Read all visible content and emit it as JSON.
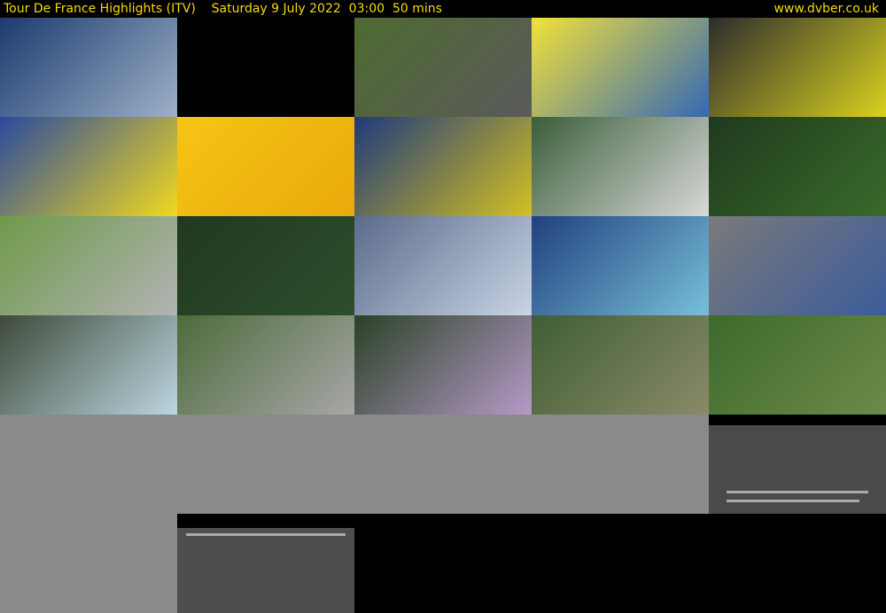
{
  "header": {
    "title": "Tour De France Highlights (ITV)",
    "date": "Saturday 9 July 2022",
    "time": "03:00",
    "duration": "50 mins",
    "site": "www.dvber.co.uk"
  },
  "thumbnails": [
    {
      "text": "",
      "colors": [
        "#1b3b6f",
        "#9db0c7"
      ]
    },
    {
      "text": "",
      "colors": [
        "#000000",
        "#000000"
      ]
    },
    {
      "text": "",
      "colors": [
        "#4e6a2f",
        "#5a5a5a"
      ]
    },
    {
      "text": "",
      "colors": [
        "#f3e13a",
        "#3469b4"
      ]
    },
    {
      "text": "",
      "colors": [
        "#2c2c2c",
        "#d8d11f"
      ]
    },
    {
      "text": "",
      "colors": [
        "#2b4a9d",
        "#f0d91f"
      ]
    },
    {
      "text": "",
      "colors": [
        "#f6c515",
        "#e9a90b"
      ]
    },
    {
      "text": "",
      "colors": [
        "#1f3a7a",
        "#d3c024"
      ]
    },
    {
      "text": "",
      "colors": [
        "#3a5e3a",
        "#d9d9d9"
      ]
    },
    {
      "text": "",
      "colors": [
        "#1e3a1e",
        "#3a6a2a"
      ]
    },
    {
      "text": "",
      "colors": [
        "#6d9a4a",
        "#b3b3b3"
      ]
    },
    {
      "text": "",
      "colors": [
        "#203820",
        "#2d4f2d"
      ]
    },
    {
      "text": "",
      "colors": [
        "#5a6b8a",
        "#c9d4e5"
      ]
    },
    {
      "text": "",
      "colors": [
        "#21407e",
        "#77c0d9"
      ]
    },
    {
      "text": "",
      "colors": [
        "#7a7a7a",
        "#3c5c9a"
      ]
    },
    {
      "text": "",
      "colors": [
        "#3e4a3a",
        "#bcd6e0"
      ]
    },
    {
      "text": "",
      "colors": [
        "#4d6b3a",
        "#a7a7a7"
      ]
    },
    {
      "text": "",
      "colors": [
        "#2a4225",
        "#b59ac7"
      ]
    },
    {
      "text": "",
      "colors": [
        "#3f5e35",
        "#8a8a6a"
      ]
    },
    {
      "text": "",
      "colors": [
        "#3d6a2c",
        "#6c8a4a"
      ]
    }
  ]
}
